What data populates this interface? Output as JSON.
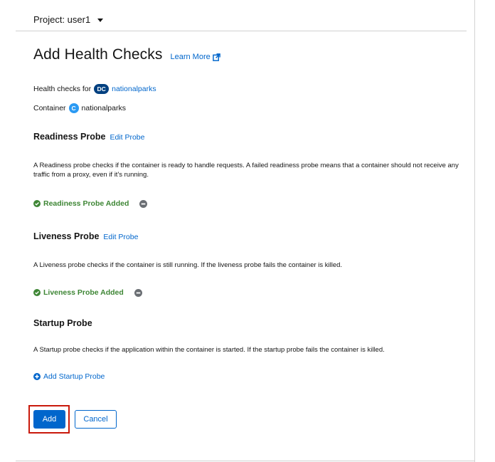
{
  "project": {
    "label": "Project: user1"
  },
  "page": {
    "title": "Add Health Checks",
    "learn_more": "Learn More"
  },
  "target": {
    "health_checks_for_label": "Health checks for",
    "resource_badge": "DC",
    "resource_name": "nationalparks",
    "container_label": "Container",
    "container_badge": "C",
    "container_name": "nationalparks"
  },
  "readiness": {
    "title": "Readiness Probe",
    "edit_label": "Edit Probe",
    "description": "A Readiness probe checks if the container is ready to handle requests. A failed readiness probe means that a container should not receive any traffic from a proxy, even if it's running.",
    "status": "Readiness Probe Added"
  },
  "liveness": {
    "title": "Liveness Probe",
    "edit_label": "Edit Probe",
    "description": "A Liveness probe checks if the container is still running. If the liveness probe fails the container is killed.",
    "status": "Liveness Probe Added"
  },
  "startup": {
    "title": "Startup Probe",
    "description": "A Startup probe checks if the application within the container is started. If the startup probe fails the container is killed.",
    "add_label": "Add Startup Probe"
  },
  "actions": {
    "add_label": "Add",
    "cancel_label": "Cancel"
  },
  "colors": {
    "link": "#0066cc",
    "success": "#3e8635",
    "primary": "#0066cc",
    "highlight": "#c9190b",
    "dc_badge": "#004080",
    "c_badge": "#2b9af3"
  },
  "icons": {
    "project_dropdown": "caret-down-icon",
    "learn_more": "external-link-icon",
    "status": "check-circle-icon",
    "remove": "minus-circle-icon",
    "add": "plus-circle-icon"
  }
}
